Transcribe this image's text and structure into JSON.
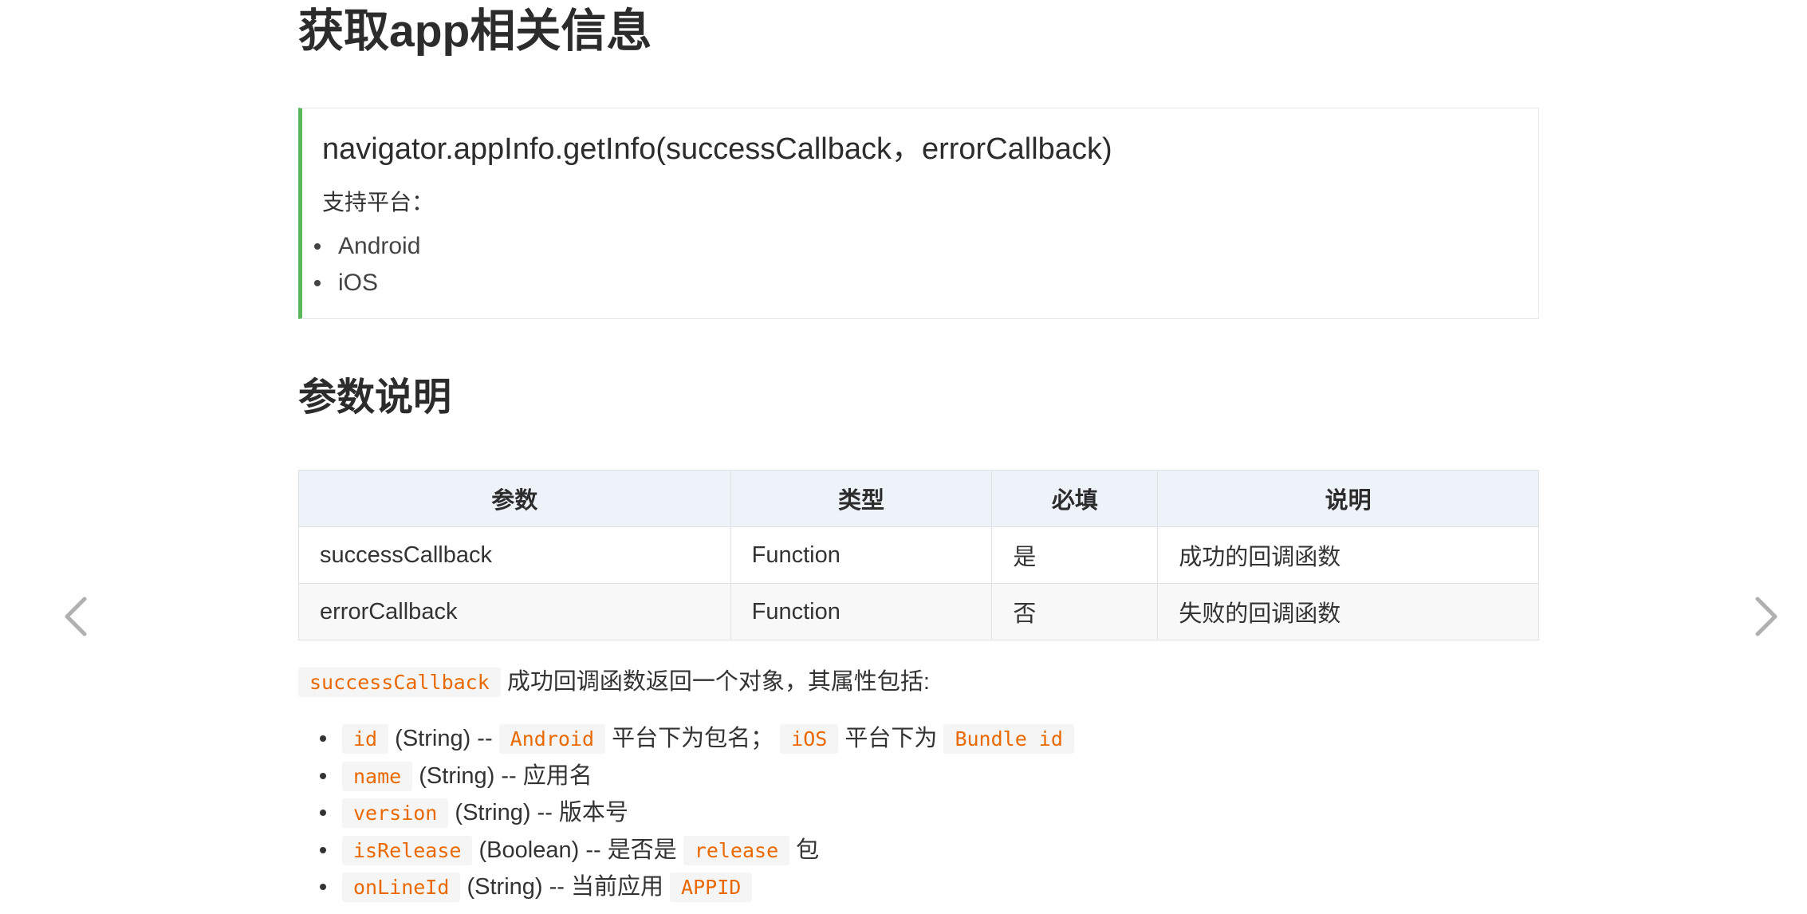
{
  "page_title": "获取app相关信息",
  "api": {
    "signature": "navigator.appInfo.getInfo(successCallback，errorCallback)",
    "platform_label": "支持平台：",
    "platforms": [
      "Android",
      "iOS"
    ]
  },
  "params_title": "参数说明",
  "params_table": {
    "headers": [
      "参数",
      "类型",
      "必填",
      "说明"
    ],
    "rows": [
      [
        "successCallback",
        "Function",
        "是",
        "成功的回调函数"
      ],
      [
        "errorCallback",
        "Function",
        "否",
        "失败的回调函数"
      ]
    ]
  },
  "description": {
    "code": "successCallback",
    "text": " 成功回调函数返回一个对象，其属性包括:"
  },
  "properties": [
    {
      "name": "id",
      "type": " (String) -- ",
      "parts": [
        {
          "code": "Android"
        },
        {
          "text": " 平台下为包名； "
        },
        {
          "code": "iOS"
        },
        {
          "text": " 平台下为 "
        },
        {
          "code": "Bundle id"
        }
      ]
    },
    {
      "name": "name",
      "type": " (String) -- 应用名",
      "parts": []
    },
    {
      "name": "version",
      "type": " (String) -- 版本号",
      "parts": []
    },
    {
      "name": "isRelease",
      "type": " (Boolean) -- 是否是 ",
      "parts": [
        {
          "code": "release"
        },
        {
          "text": " 包"
        }
      ]
    },
    {
      "name": "onLineId",
      "type": " (String) -- 当前应用 ",
      "parts": [
        {
          "code": "APPID"
        }
      ]
    }
  ],
  "navigation": {
    "prev_icon": "chevron-left-icon",
    "next_icon": "chevron-right-icon"
  },
  "colors": {
    "accent_border": "#5cb85c",
    "code_text": "#e96900",
    "code_bg": "#f5f5f5",
    "table_header_bg": "#eef3fa"
  }
}
